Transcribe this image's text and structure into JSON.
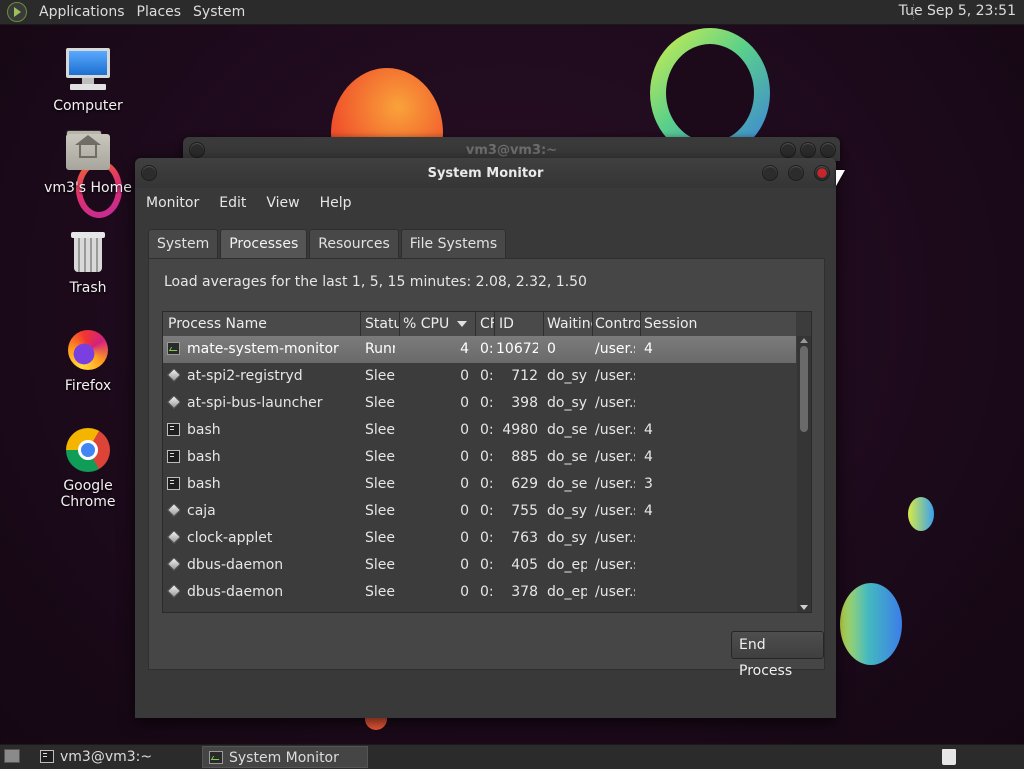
{
  "top_panel": {
    "menus": [
      "Applications",
      "Places",
      "System"
    ],
    "clock": "Tue Sep  5, 23:51"
  },
  "desktop_icons": [
    {
      "label": "Computer",
      "icon": "computer-icon"
    },
    {
      "label": "vm3's Home",
      "icon": "home-folder-icon"
    },
    {
      "label": "Trash",
      "icon": "trash-icon"
    },
    {
      "label": "Firefox",
      "icon": "firefox-icon"
    },
    {
      "label": "Google Chrome",
      "icon": "chrome-icon"
    }
  ],
  "terminal_window": {
    "title": "vm3@vm3:~"
  },
  "sysmon": {
    "title": "System Monitor",
    "menus": [
      "Monitor",
      "Edit",
      "View",
      "Help"
    ],
    "tabs": [
      "System",
      "Processes",
      "Resources",
      "File Systems"
    ],
    "active_tab": "Processes",
    "load_averages": "Load averages for the last 1, 5, 15 minutes: 2.08, 2.32, 1.50",
    "columns": [
      "Process Name",
      "Statu",
      "% CPU",
      "CF",
      "ID",
      "Waiting",
      "Contro",
      "Session"
    ],
    "rows": [
      {
        "icon": "system-monitor-icon",
        "name": "mate-system-monitor",
        "status": "Runn",
        "cpu": "4",
        "cputime": "0:",
        "id": "10672",
        "waiting": "0",
        "control": "/user.s",
        "session": "4",
        "selected": true
      },
      {
        "icon": "process-icon",
        "name": "at-spi2-registryd",
        "status": "Sleep",
        "cpu": "0",
        "cputime": "0:",
        "id": "712",
        "waiting": "do_sys",
        "control": "/user.s",
        "session": ""
      },
      {
        "icon": "process-icon",
        "name": "at-spi-bus-launcher",
        "status": "Sleep",
        "cpu": "0",
        "cputime": "0:",
        "id": "398",
        "waiting": "do_sys",
        "control": "/user.s",
        "session": ""
      },
      {
        "icon": "terminal-icon",
        "name": "bash",
        "status": "Sleep",
        "cpu": "0",
        "cputime": "0:",
        "id": "4980",
        "waiting": "do_sel",
        "control": "/user.s",
        "session": "4"
      },
      {
        "icon": "terminal-icon",
        "name": "bash",
        "status": "Sleep",
        "cpu": "0",
        "cputime": "0:",
        "id": "885",
        "waiting": "do_sel",
        "control": "/user.s",
        "session": "4"
      },
      {
        "icon": "terminal-icon",
        "name": "bash",
        "status": "Sleep",
        "cpu": "0",
        "cputime": "0:",
        "id": "629",
        "waiting": "do_sel",
        "control": "/user.s",
        "session": "3"
      },
      {
        "icon": "process-icon",
        "name": "caja",
        "status": "Sleep",
        "cpu": "0",
        "cputime": "0:",
        "id": "755",
        "waiting": "do_sys",
        "control": "/user.s",
        "session": "4"
      },
      {
        "icon": "process-icon",
        "name": "clock-applet",
        "status": "Sleep",
        "cpu": "0",
        "cputime": "0:",
        "id": "763",
        "waiting": "do_sys",
        "control": "/user.s",
        "session": ""
      },
      {
        "icon": "process-icon",
        "name": "dbus-daemon",
        "status": "Sleep",
        "cpu": "0",
        "cputime": "0:",
        "id": "405",
        "waiting": "do_ep",
        "control": "/user.s",
        "session": ""
      },
      {
        "icon": "process-icon",
        "name": "dbus-daemon",
        "status": "Sleep",
        "cpu": "0",
        "cputime": "0:",
        "id": "378",
        "waiting": "do_ep",
        "control": "/user.s",
        "session": ""
      }
    ],
    "end_process_label": "End Process"
  },
  "bottom_panel": {
    "tasks": [
      {
        "label": "vm3@vm3:~",
        "icon": "terminal-icon"
      },
      {
        "label": "System Monitor",
        "icon": "system-monitor-icon",
        "active": true
      }
    ]
  }
}
